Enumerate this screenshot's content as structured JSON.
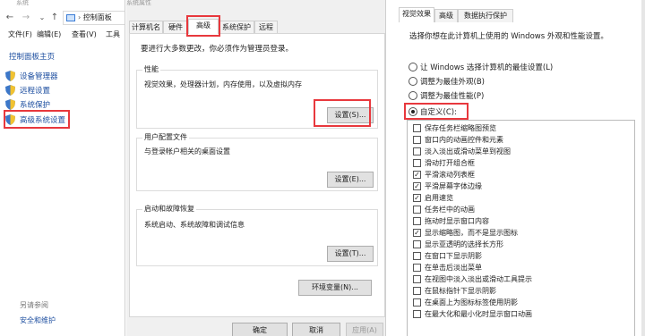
{
  "control_panel": {
    "window_title": "系统",
    "address": "控制面板",
    "menu": [
      "文件(F)",
      "编辑(E)",
      "查看(V)",
      "工具"
    ],
    "home_link": "控制面板主页",
    "links": [
      "设备管理器",
      "远程设置",
      "系统保护",
      "高级系统设置"
    ],
    "see_also_title": "另请参阅",
    "see_also_link": "安全和维护"
  },
  "system_properties": {
    "window_title": "系统属性",
    "tabs": [
      "计算机名",
      "硬件",
      "高级",
      "系统保护",
      "远程"
    ],
    "active_tab": "高级",
    "admin_note": "要进行大多数更改，你必须作为管理员登录。",
    "groups": [
      {
        "title": "性能",
        "desc": "视觉效果，处理器计划，内存使用，以及虚拟内存",
        "button": "设置(S)..."
      },
      {
        "title": "用户配置文件",
        "desc": "与登录帐户相关的桌面设置",
        "button": "设置(E)..."
      },
      {
        "title": "启动和故障恢复",
        "desc": "系统启动、系统故障和调试信息",
        "button": "设置(T)..."
      }
    ],
    "env_button": "环境变量(N)...",
    "ok": "确定",
    "cancel": "取消",
    "apply": "应用(A)"
  },
  "performance_options": {
    "tabs": [
      "视觉效果",
      "高级",
      "数据执行保护"
    ],
    "active_tab": "视觉效果",
    "description": "选择你想在此计算机上使用的 Windows 外观和性能设置。",
    "radios": [
      {
        "label": "让 Windows 选择计算机的最佳设置(L)",
        "selected": false
      },
      {
        "label": "调整为最佳外观(B)",
        "selected": false
      },
      {
        "label": "调整为最佳性能(P)",
        "selected": false
      },
      {
        "label": "自定义(C):",
        "selected": true
      }
    ],
    "effects": [
      {
        "label": "保存任务栏缩略图预览",
        "checked": false
      },
      {
        "label": "窗口内的动画控件和元素",
        "checked": false
      },
      {
        "label": "淡入淡出或滑动菜单到视图",
        "checked": false
      },
      {
        "label": "滑动打开组合框",
        "checked": false
      },
      {
        "label": "平滑滚动列表框",
        "checked": true
      },
      {
        "label": "平滑屏幕字体边缘",
        "checked": true
      },
      {
        "label": "启用速览",
        "checked": true
      },
      {
        "label": "任务栏中的动画",
        "checked": false
      },
      {
        "label": "拖动时显示窗口内容",
        "checked": false
      },
      {
        "label": "显示缩略图，而不是显示图标",
        "checked": true
      },
      {
        "label": "显示亚透明的选择长方形",
        "checked": false
      },
      {
        "label": "在窗口下显示阴影",
        "checked": false
      },
      {
        "label": "在单击后淡出菜单",
        "checked": false
      },
      {
        "label": "在视图中淡入淡出或滑动工具提示",
        "checked": false
      },
      {
        "label": "在鼠标指针下显示阴影",
        "checked": false
      },
      {
        "label": "在桌面上为图标标签使用阴影",
        "checked": false
      },
      {
        "label": "在最大化和最小化时显示窗口动画",
        "checked": false
      }
    ]
  },
  "colors": {
    "highlight_red": "#e8383d",
    "link_blue": "#1e4fa0"
  }
}
